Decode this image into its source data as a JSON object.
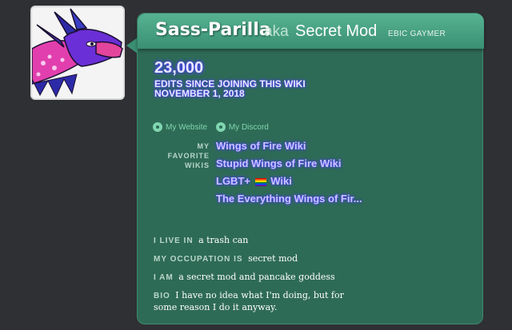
{
  "profile": {
    "avatar_icon": "dragon-avatar-icon",
    "name": "Sass-Parilla",
    "aka": "aka",
    "alt_name": "Secret Mod",
    "tag": "EBIC GAYMER"
  },
  "edits": {
    "count": "23,000",
    "line1": "EDITS SINCE JOINING THIS WIKI",
    "line2": "NOVEMBER 1, 2018"
  },
  "links": [
    {
      "label": "My Website",
      "icon": "website-icon"
    },
    {
      "label": "My Discord",
      "icon": "discord-icon"
    }
  ],
  "favorites": {
    "label_line1": "MY",
    "label_line2": "FAVORITE",
    "label_line3": "WIKIS",
    "items": [
      {
        "label": "Wings of Fire Wiki"
      },
      {
        "label": "Stupid Wings of Fire Wiki"
      },
      {
        "label_before": "LGBT+",
        "label_after": "Wiki",
        "icon": "rainbow-flag-icon"
      },
      {
        "label": "The Everything Wings of Fir..."
      }
    ]
  },
  "facts": [
    {
      "label": "I LIVE IN",
      "value": "a trash can"
    },
    {
      "label": "MY OCCUPATION IS",
      "value": "secret mod"
    },
    {
      "label": "I AM",
      "value": "a secret mod and pancake goddess"
    },
    {
      "label": "BIO",
      "value": "I have no idea what I'm doing, but for some reason I do it anyway."
    }
  ],
  "colors": {
    "page_bg": "#2f3033",
    "card_bg": "#2e6b56",
    "header_accent": "#56b392",
    "glow": "#4a3cff"
  }
}
